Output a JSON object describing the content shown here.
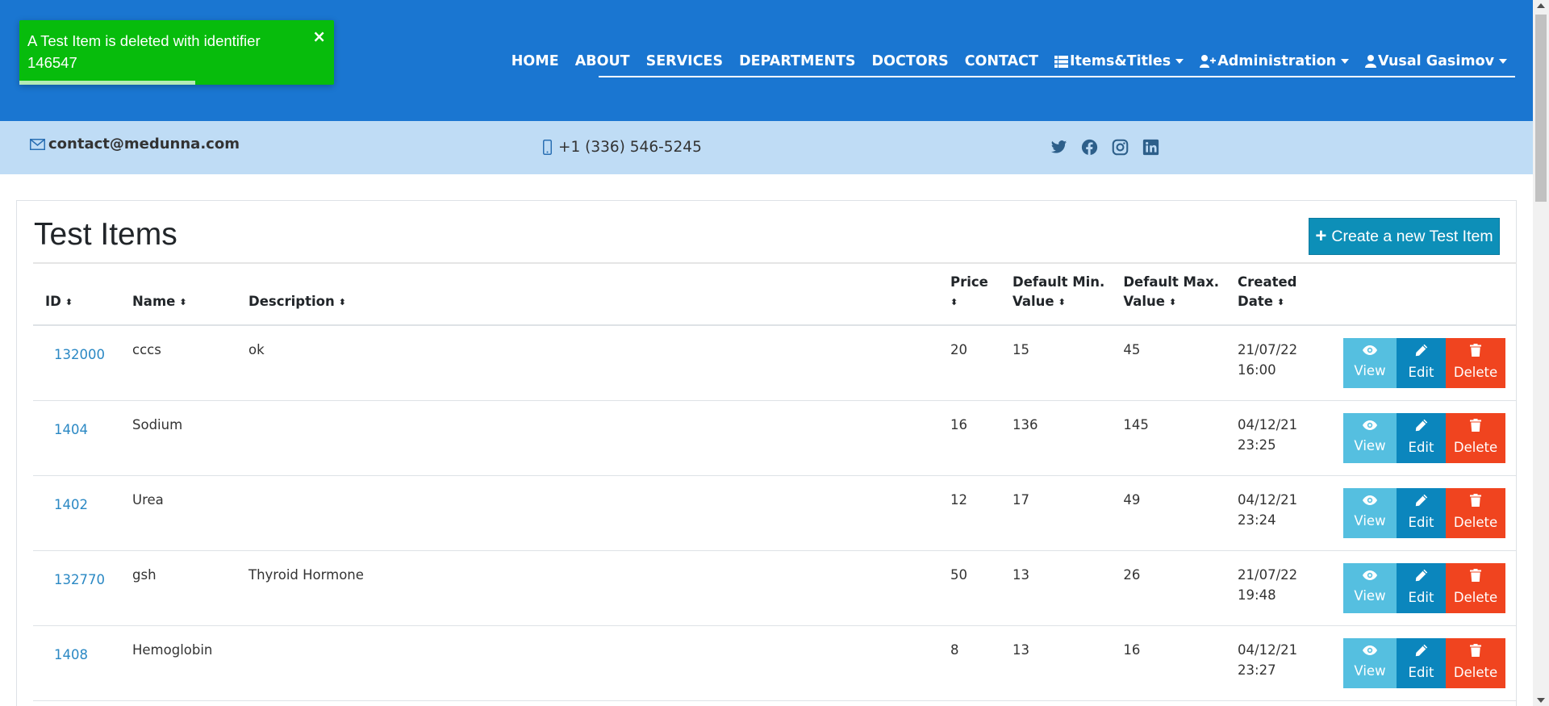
{
  "colors": {
    "header": "#1a76d1",
    "contact_bar": "#bfdcf5",
    "toast": "#07bc0c",
    "view": "#55bfe0",
    "edit": "#0b86bd",
    "delete": "#f0441f",
    "link": "#2a88c4"
  },
  "toast": {
    "message": "A Test Item is deleted with identifier 146547",
    "close": "×",
    "icon": "close-icon",
    "progress": 0.56
  },
  "nav": {
    "home": "HOME",
    "about": "ABOUT",
    "services": "SERVICES",
    "departments": "DEPARTMENTS",
    "doctors": "DOCTORS",
    "contact": "CONTACT",
    "items_titles": "Items&Titles",
    "administration": "Administration",
    "user": "Vusal Gasimov"
  },
  "contact": {
    "email": "contact@medunna.com",
    "phone": "+1 (336) 546-5245",
    "social_icons": [
      "twitter-icon",
      "facebook-icon",
      "instagram-icon",
      "linkedin-icon"
    ]
  },
  "page": {
    "title": "Test Items",
    "create_button": "Create a new Test Item"
  },
  "table": {
    "headers": {
      "id": "ID",
      "name": "Name",
      "description": "Description",
      "price": "Price",
      "min": "Default Min. Value",
      "min_line1": "Default Min.",
      "min_line2": "Value",
      "max_line1": "Default Max.",
      "max_line2": "Value",
      "created_line1": "Created",
      "created_line2": "Date"
    },
    "action_labels": {
      "view": "View",
      "edit": "Edit",
      "delete": "Delete"
    },
    "rows": [
      {
        "id": "132000",
        "name": "cccs",
        "description": "ok",
        "price": "20",
        "min": "15",
        "max": "45",
        "date": "21/07/22",
        "time": "16:00"
      },
      {
        "id": "1404",
        "name": "Sodium",
        "description": "",
        "price": "16",
        "min": "136",
        "max": "145",
        "date": "04/12/21",
        "time": "23:25"
      },
      {
        "id": "1402",
        "name": "Urea",
        "description": "",
        "price": "12",
        "min": "17",
        "max": "49",
        "date": "04/12/21",
        "time": "23:24"
      },
      {
        "id": "132770",
        "name": "gsh",
        "description": "Thyroid Hormone",
        "price": "50",
        "min": "13",
        "max": "26",
        "date": "21/07/22",
        "time": "19:48"
      },
      {
        "id": "1408",
        "name": "Hemoglobin",
        "description": "",
        "price": "8",
        "min": "13",
        "max": "16",
        "date": "04/12/21",
        "time": "23:27"
      }
    ]
  }
}
